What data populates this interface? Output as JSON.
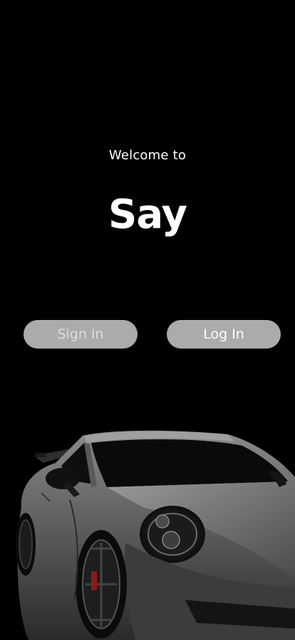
{
  "welcome": {
    "subtitle": "Welcome to",
    "title": "Say"
  },
  "buttons": {
    "sign_in": "Sign In",
    "log_in": "Log In"
  },
  "colors": {
    "background": "#000000",
    "button_bg": "#ababab",
    "text": "#ffffff"
  },
  "image": {
    "name": "sports-car-photo"
  }
}
